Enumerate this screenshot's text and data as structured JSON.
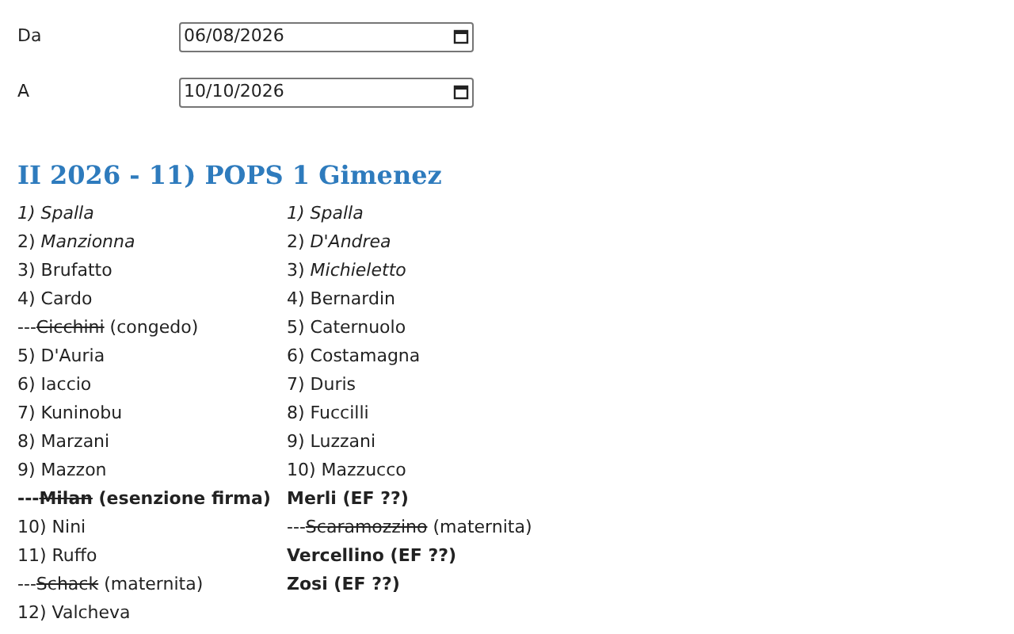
{
  "date_fields": [
    {
      "label": "Da",
      "value": "06/08/2026"
    },
    {
      "label": "A",
      "value": "10/10/2026"
    }
  ],
  "heading": "II 2026 - 11) POPS 1 Gimenez",
  "columns": [
    {
      "items": [
        {
          "kind": "italic",
          "text": "1) Spalla"
        },
        {
          "kind": "plain",
          "text": "2) *Manzionna*"
        },
        {
          "kind": "plain",
          "text": "3) Brufatto"
        },
        {
          "kind": "plain",
          "text": "4) Cardo"
        },
        {
          "kind": "plain",
          "before": "---",
          "struck": "Cicchini",
          "after": " (congedo)"
        },
        {
          "kind": "plain",
          "text": "5) D'Auria"
        },
        {
          "kind": "plain",
          "text": "6) Iaccio"
        },
        {
          "kind": "plain",
          "text": "7) Kuninobu"
        },
        {
          "kind": "plain",
          "text": "8) Marzani"
        },
        {
          "kind": "plain",
          "text": "9) Mazzon"
        },
        {
          "kind": "bold",
          "before": "---",
          "struck": "Milan",
          "after": " (esenzione firma)"
        },
        {
          "kind": "plain",
          "text": "10) Nini"
        },
        {
          "kind": "plain",
          "text": "11) Ruffo"
        },
        {
          "kind": "plain",
          "before": "---",
          "struck": "Schack",
          "after": " (maternita)"
        },
        {
          "kind": "plain",
          "text": "12) Valcheva"
        }
      ]
    },
    {
      "items": [
        {
          "kind": "italic",
          "text": "1) Spalla"
        },
        {
          "kind": "plain",
          "text": "2) *D'Andrea*"
        },
        {
          "kind": "plain",
          "text": "3) *Michieletto*"
        },
        {
          "kind": "plain",
          "text": "4) Bernardin"
        },
        {
          "kind": "plain",
          "text": "5) Caternuolo"
        },
        {
          "kind": "plain",
          "text": "6) Costamagna"
        },
        {
          "kind": "plain",
          "text": "7) Duris"
        },
        {
          "kind": "plain",
          "text": "8) Fuccilli"
        },
        {
          "kind": "plain",
          "text": "9) Luzzani"
        },
        {
          "kind": "plain",
          "text": "10) Mazzucco"
        },
        {
          "kind": "bold",
          "text": "Merli (EF ??)"
        },
        {
          "kind": "plain",
          "before": "---",
          "struck": "Scaramozzino",
          "after": " (maternita)"
        },
        {
          "kind": "bold",
          "text": "Vercellino (EF ??)"
        },
        {
          "kind": "bold",
          "text": "Zosi (EF ??)"
        }
      ]
    }
  ]
}
